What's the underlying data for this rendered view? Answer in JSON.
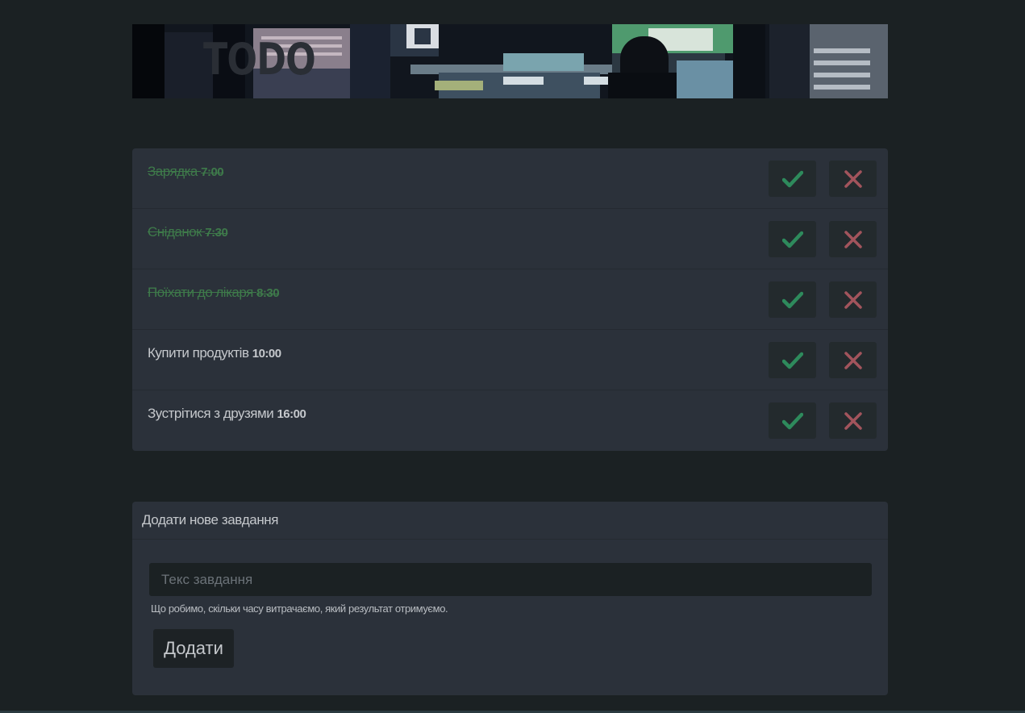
{
  "banner": {
    "title": "TODO"
  },
  "todos": [
    {
      "text": "Зарядка",
      "time": "7:00",
      "done": true
    },
    {
      "text": "Сніданок",
      "time": "7:30",
      "done": true
    },
    {
      "text": "Поїхати до лікаря",
      "time": "8:30",
      "done": true
    },
    {
      "text": "Купити продуктів",
      "time": "10:00",
      "done": false
    },
    {
      "text": "Зустрітися з друзями",
      "time": "16:00",
      "done": false
    }
  ],
  "add_form": {
    "header": "Додати нове завдання",
    "input_placeholder": "Текс завдання",
    "input_value": "",
    "hint": "Що робимо, скільки часу витрачаємо, який результат отримуємо.",
    "submit_label": "Додати"
  },
  "colors": {
    "check": "#2e8a5c",
    "cross": "#a2545c",
    "done_text": "#3e7a4a"
  },
  "icons": {
    "done": "check-icon",
    "delete": "close-icon"
  }
}
